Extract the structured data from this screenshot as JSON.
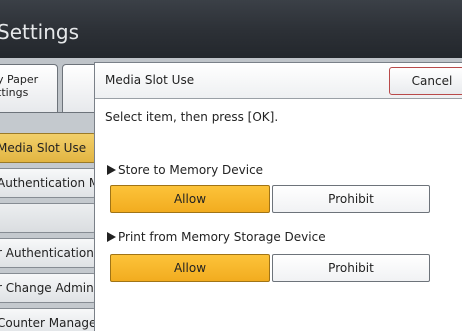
{
  "header": {
    "title": "Settings"
  },
  "left_tabs": [
    {
      "label_line1": "y Paper",
      "label_line2": "ttings"
    },
    {
      "label_line1": "",
      "label_line2": ""
    }
  ],
  "left_menu": [
    {
      "label": "Media Slot Use",
      "selected": true
    },
    {
      "label": "Authentication Mar",
      "selected": false
    },
    {
      "label": "",
      "selected": false
    },
    {
      "label": "r Authentication",
      "selected": false
    },
    {
      "label": "r Change Admin",
      "selected": false
    },
    {
      "label": "Counter Manager",
      "selected": false
    }
  ],
  "dialog": {
    "title": "Media Slot Use",
    "cancel_label": "Cancel",
    "instruction": "Select item, then press [OK].",
    "sections": [
      {
        "label": "Store to Memory Device",
        "allow_label": "Allow",
        "prohibit_label": "Prohibit",
        "selected": "Allow"
      },
      {
        "label": "Print from Memory Storage Device",
        "allow_label": "Allow",
        "prohibit_label": "Prohibit",
        "selected": "Allow"
      }
    ]
  },
  "colors": {
    "header_bg": "#2d3137",
    "selected_option": "#f7b82b",
    "selected_menu": "#e8c155",
    "cancel_border": "#b94a4a"
  }
}
